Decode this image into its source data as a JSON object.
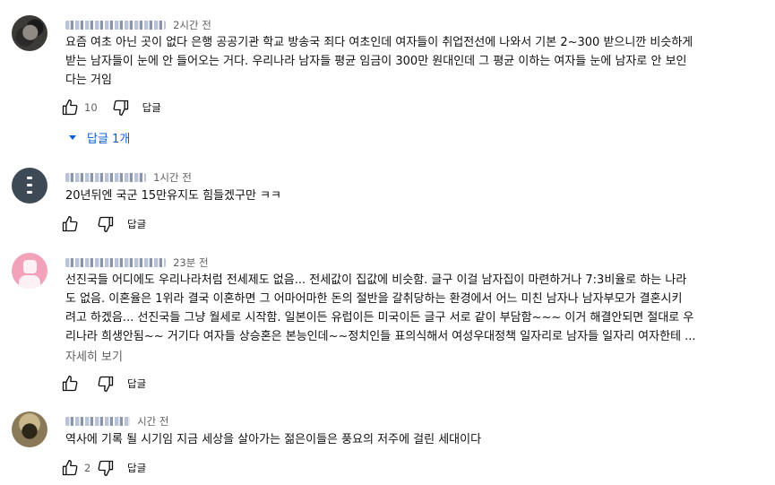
{
  "comments": [
    {
      "time": "2시간 전",
      "lines": [
        "요즘 여초 아닌 곳이 없다 은행 공공기관 학교 방송국 죄다 여초인데 여자들이 취업전선에 나와서 기본 2~300 받으니깐 비슷하게",
        "받는 남자들이 눈에 안 들어오는 거다. 우리나라 남자들 평균 임금이 300만 원대인데 그 평균 이하는 여자들 눈에 남자로 안 보인",
        "다는 거임"
      ],
      "likes": "10",
      "reply_label": "답글",
      "replies_toggle": "답글 1개"
    },
    {
      "time": "1시간 전",
      "lines": [
        "20년뒤엔 국군 15만유지도 힘들겠구만 ㅋㅋ"
      ],
      "likes": "",
      "reply_label": "답글"
    },
    {
      "time": "23분 전",
      "lines": [
        "선진국들 어디에도 우리나라처럼 전세제도 없음... 전세값이 집값에 비슷함. 글구 이걸 남자집이 마련하거나 7:3비율로 하는 나라",
        "도 없음. 이혼율은 1위라 결국 이혼하면 그 어마어마한 돈의 절반을 갈취당하는 환경에서 어느 미친 남자나 남자부모가 결혼시키",
        "려고 하겠음... 선진국들 그냥 월세로 시작함. 일본이든 유럽이든 미국이든 글구 서로 같이 부담함~~~ 이거 해결안되면 절대로 우",
        "리나라 희생안됨~~ 거기다 여자들 상승혼은 본능인데~~정치인들 표의식해서 여성우대정책 일자리로 남자들 일자리 여자한테 ..."
      ],
      "more_label": "자세히 보기",
      "likes": "",
      "reply_label": "답글"
    },
    {
      "time": "시간 전",
      "lines": [
        "역사에 기록 될 시기임 지금 세상을 살아가는 젊은이들은 풍요의 저주에 걸린 세대이다"
      ],
      "likes": "2",
      "reply_label": "답글"
    }
  ],
  "icons": {
    "like": "thumb-up-icon",
    "dislike": "thumb-down-icon",
    "expand": "caret-down-icon"
  },
  "colors": {
    "link": "#065fd4",
    "secondary": "#606060",
    "text": "#0f0f0f"
  }
}
